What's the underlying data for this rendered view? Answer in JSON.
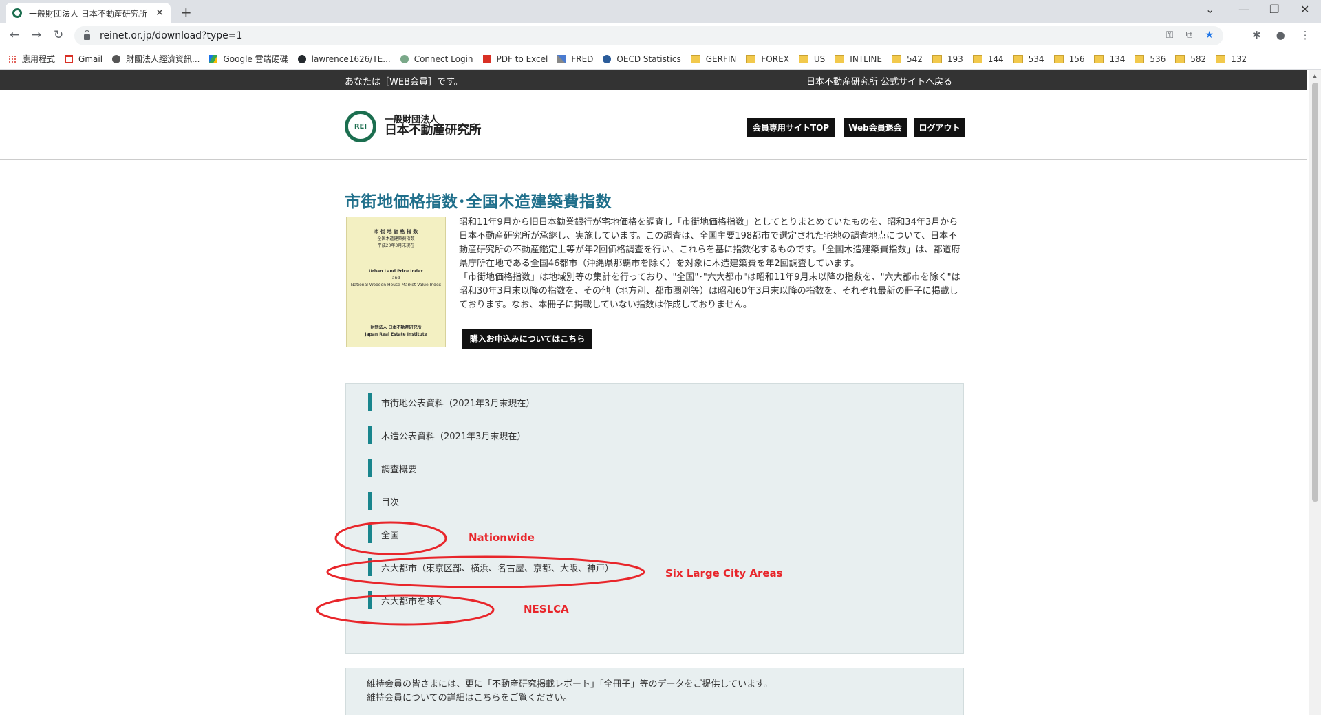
{
  "browser": {
    "tab_title": "一般財団法人 日本不動産研究所",
    "url": "reinet.or.jp/download?type=1",
    "bookmarks": [
      {
        "label": "應用程式",
        "icon": "apps-icon"
      },
      {
        "label": "Gmail",
        "icon": "gmail-icon"
      },
      {
        "label": "財團法人經濟資訊...",
        "icon": "globe-icon"
      },
      {
        "label": "Google 雲端硬碟",
        "icon": "drive-icon"
      },
      {
        "label": "lawrence1626/TE...",
        "icon": "github-icon"
      },
      {
        "label": "Connect Login",
        "icon": "connect-icon"
      },
      {
        "label": "PDF to Excel",
        "icon": "pdf-icon"
      },
      {
        "label": "FRED",
        "icon": "chart-icon"
      },
      {
        "label": "OECD Statistics",
        "icon": "oecd-icon"
      },
      {
        "label": "GERFIN",
        "icon": "folder-icon"
      },
      {
        "label": "FOREX",
        "icon": "folder-icon"
      },
      {
        "label": "US",
        "icon": "folder-icon"
      },
      {
        "label": "INTLINE",
        "icon": "folder-icon"
      },
      {
        "label": "542",
        "icon": "folder-icon"
      },
      {
        "label": "193",
        "icon": "folder-icon"
      },
      {
        "label": "144",
        "icon": "folder-icon"
      },
      {
        "label": "534",
        "icon": "folder-icon"
      },
      {
        "label": "156",
        "icon": "folder-icon"
      },
      {
        "label": "134",
        "icon": "folder-icon"
      },
      {
        "label": "536",
        "icon": "folder-icon"
      },
      {
        "label": "582",
        "icon": "folder-icon"
      },
      {
        "label": "132",
        "icon": "folder-icon"
      }
    ]
  },
  "topbar": {
    "member_status": "あなたは［WEB会員］です。",
    "official_site_link": "日本不動産研究所 公式サイトへ戻る"
  },
  "header": {
    "logo_mark": "REI",
    "logo_sub": "一般財団法人",
    "logo_main": "日本不動産研究所",
    "buttons": [
      "会員専用サイトTOP",
      "Web会員退会",
      "ログアウト"
    ]
  },
  "main": {
    "title": "市街地価格指数･全国木造建築費指数",
    "cover": {
      "title_jp_1": "市 街 地 価 格 指 数",
      "title_jp_2": "全国木造建築費指数",
      "title_jp_3": "平成20年3月末現在",
      "title_en_1": "Urban Land Price Index",
      "title_en_2": "and",
      "title_en_3": "National Wooden House Market Value Index",
      "org_jp": "財団法人 日本不動産研究所",
      "org_en": "Japan Real Estate Institute"
    },
    "intro_paragraphs": [
      "昭和11年9月から旧日本勧業銀行が宅地価格を調査し「市街地価格指数」としてとりまとめていたものを、昭和34年3月から日本不動産研究所が承継し、実施しています。この調査は、全国主要198都市で選定された宅地の調査地点について、日本不動産研究所の不動産鑑定士等が年2回価格調査を行い、これらを基に指数化するものです。「全国木造建築費指数」は、都道府県庁所在地である全国46都市（沖縄県那覇市を除く）を対象に木造建築費を年2回調査しています。",
      "「市街地価格指数」は地域別等の集計を行っており、\"全国\"･\"六大都市\"は昭和11年9月末以降の指数を、\"六大都市を除く\"は昭和30年3月末以降の指数を、その他（地方別、都市圏別等）は昭和60年3月末以降の指数を、それぞれ最新の冊子に掲載しております。なお、本冊子に掲載していない指数は作成しておりません。"
    ],
    "purchase_button": "購入お申込みについてはこちら",
    "download_items": [
      "市街地公表資料（2021年3月末現在）",
      "木造公表資料（2021年3月末現在）",
      "調査概要",
      "目次",
      "全国",
      "六大都市（東京区部、横浜、名古屋、京都、大阪、神戸）",
      "六大都市を除く"
    ],
    "member_notice": [
      "維持会員の皆さまには、更に「不動産研究掲載レポート」「全冊子」等のデータをご提供しています。",
      "維持会員についての詳細はこちらをご覧ください。"
    ]
  },
  "annotations": {
    "nationwide": "Nationwide",
    "six_large": "Six Large City Areas",
    "neslca": "NESLCA",
    "color": "#e8262b"
  }
}
